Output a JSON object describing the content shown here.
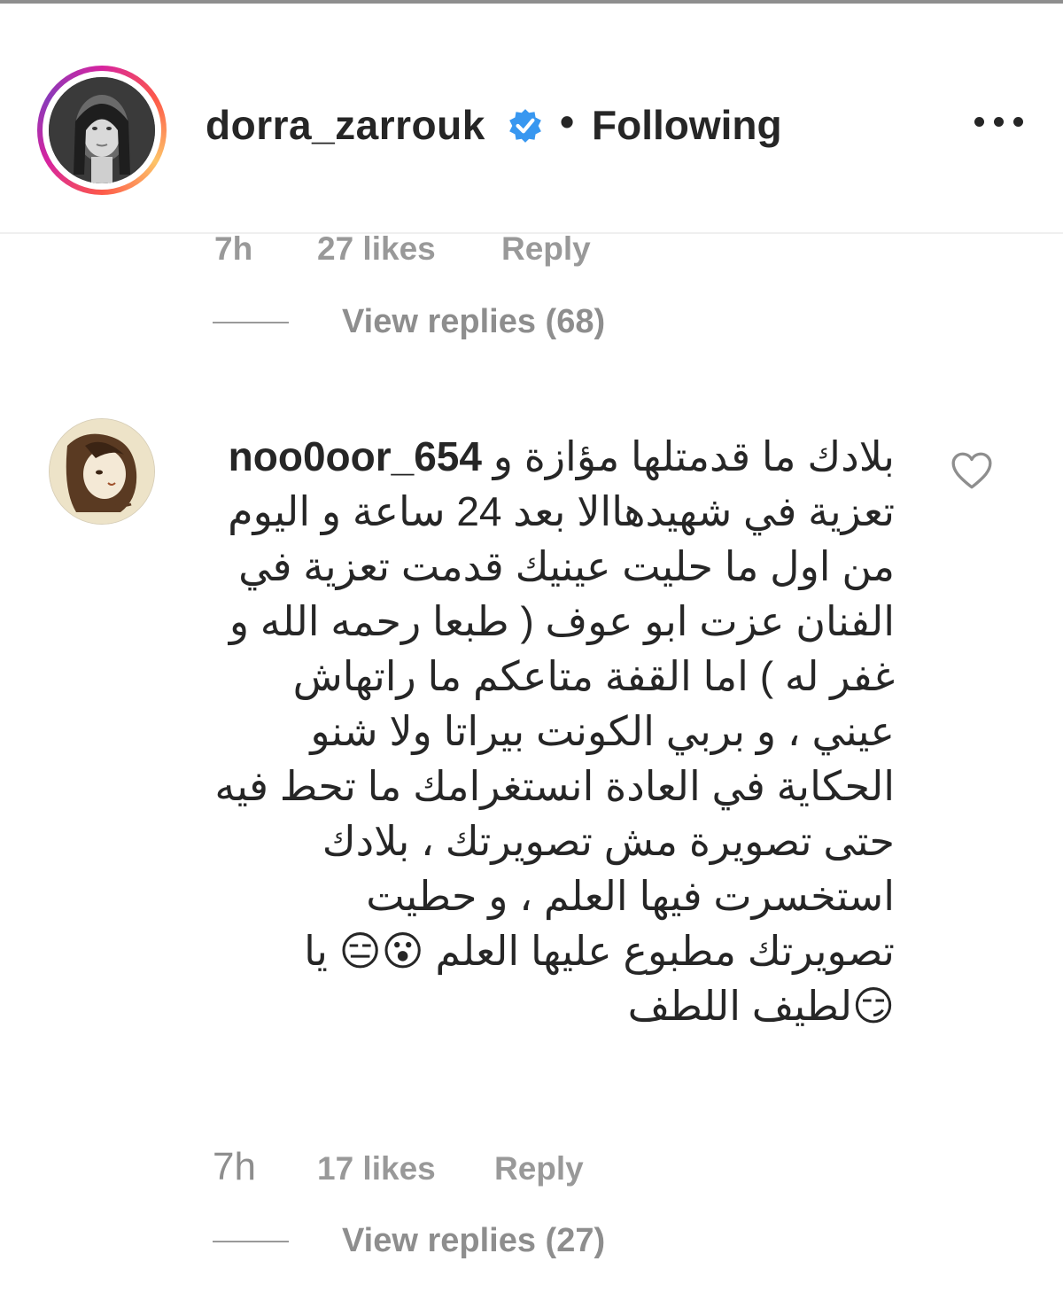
{
  "header": {
    "username": "dorra_zarrouk",
    "separator": "•",
    "follow_status": "Following"
  },
  "previous_comment": {
    "time": "7h",
    "likes": "27 likes",
    "reply": "Reply",
    "view_replies": "View replies (68)"
  },
  "comment": {
    "username": "noo0oor_654",
    "text": "بلادك ما قدمتلها مؤازة و تعزية في شهيدهاالا بعد 24 ساعة و اليوم من اول ما حليت عينيك قدمت تعزية في الفنان عزت ابو عوف ( طبعا رحمه الله و غفر له ) اما القفة متاعكم ما راتهاش عيني ، و بربي الكونت بيراتا ولا شنو الحكاية في العادة انستغرامك ما تحط فيه حتى تصويرة مش تصويرتك ، بلادك استخسرت فيها العلم ، و حطيت تصويرتك مطبوع عليها العلم 😮😑 يا لطيف اللطف😏",
    "time": "7h",
    "likes": "17 likes",
    "reply": "Reply",
    "view_replies": "View replies (27)"
  },
  "icons": {
    "verified": "verified-badge-icon",
    "more": "more-options-icon",
    "like": "heart-icon"
  },
  "colors": {
    "verified": "#3897f0",
    "text": "#262626",
    "muted": "#999999"
  }
}
